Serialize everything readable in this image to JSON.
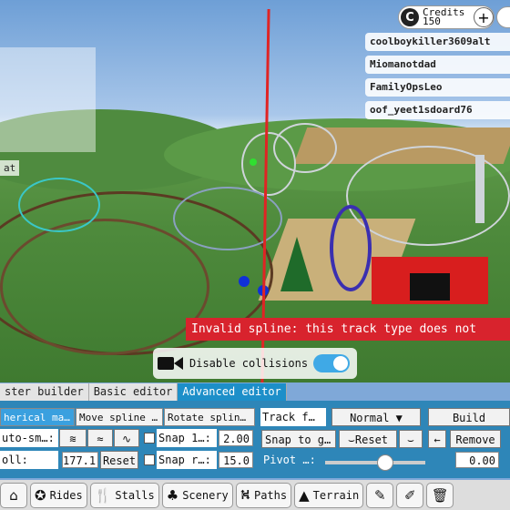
{
  "hud": {
    "credits_label": "Credits",
    "credits_value": "150",
    "credits_icon": "C",
    "plus_label": "+",
    "players": [
      "coolboykiller3609alt",
      "Miomanotdad",
      "FamilyOpsLeo",
      "oof_yeet1sdoard76"
    ],
    "minimap_label": "at"
  },
  "error": {
    "text": "Invalid spline: this track type does not"
  },
  "collisions": {
    "label": "Disable collisions",
    "enabled": true
  },
  "tabs": [
    {
      "label": "ster builder",
      "active": false
    },
    {
      "label": "Basic editor",
      "active": false
    },
    {
      "label": "Advanced editor",
      "active": true
    }
  ],
  "editor": {
    "row1": {
      "spherical": "herical ma…",
      "move_spline": "Move spline …",
      "rotate_spline": "Rotate splin…",
      "track_label": "Track f…",
      "track_value": "Normal",
      "build": "Build"
    },
    "row2": {
      "auto_smooth": "uto-sm…:",
      "snap1_label": "Snap 1…:",
      "snap1_value": "2.00",
      "snap_to_g": "Snap to g…",
      "reset": "Reset",
      "remove": "Remove"
    },
    "row3": {
      "roll_label": "oll:",
      "roll_value": "177.1",
      "roll_reset": "Reset",
      "snapr_label": "Snap r…:",
      "snapr_value": "15.0",
      "pivot_label": "Pivot …:",
      "pivot_value": "0.00"
    }
  },
  "toolbar": {
    "rides": "Rides",
    "stalls": "Stalls",
    "scenery": "Scenery",
    "paths": "Paths",
    "terrain": "Terrain"
  },
  "colors": {
    "accent": "#1d8fc9",
    "error": "#d8232d",
    "toggle_on": "#3fa9e6"
  }
}
